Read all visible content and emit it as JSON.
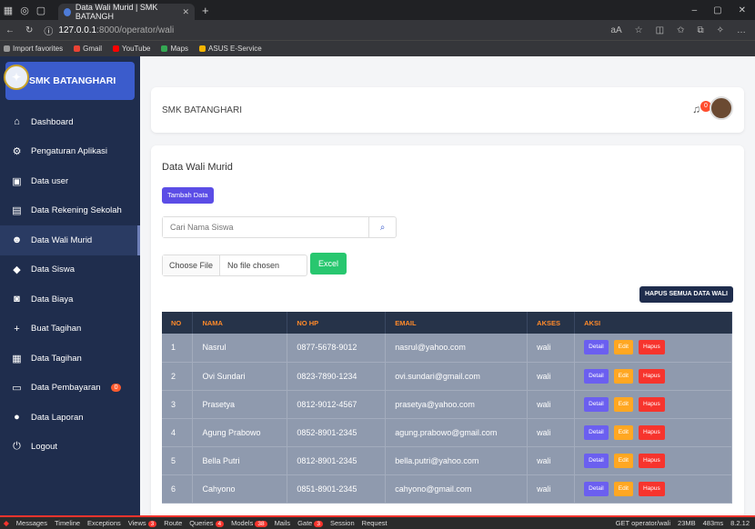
{
  "browser": {
    "tab_title": "Data Wali Murid | SMK BATANGH",
    "url_host": "127.0.0.1",
    "url_path": ":8000/operator/wali",
    "bookmarks": [
      {
        "label": "Import favorites",
        "color": "#999999"
      },
      {
        "label": "Gmail",
        "color": "#ea4335"
      },
      {
        "label": "YouTube",
        "color": "#ff0000"
      },
      {
        "label": "Maps",
        "color": "#34a853"
      },
      {
        "label": "ASUS E-Service",
        "color": "#f4b400"
      }
    ]
  },
  "sidebar": {
    "brand": "SMK BATANGHARI",
    "items": [
      {
        "label": "Dashboard",
        "icon": "home-icon",
        "glyph": "⌂"
      },
      {
        "label": "Pengaturan Aplikasi",
        "icon": "gear-icon",
        "glyph": "⚙"
      },
      {
        "label": "Data user",
        "icon": "user-icon",
        "glyph": "▣"
      },
      {
        "label": "Data Rekening Sekolah",
        "icon": "bank-icon",
        "glyph": "▤"
      },
      {
        "label": "Data Wali Murid",
        "icon": "users-icon",
        "glyph": "☻",
        "active": true
      },
      {
        "label": "Data Siswa",
        "icon": "graduation-cap-icon",
        "glyph": "◆"
      },
      {
        "label": "Data Biaya",
        "icon": "money-icon",
        "glyph": "◙"
      },
      {
        "label": "Buat Tagihan",
        "icon": "plus-icon",
        "glyph": "+"
      },
      {
        "label": "Data Tagihan",
        "icon": "invoice-icon",
        "glyph": "▦"
      },
      {
        "label": "Data Pembayaran",
        "icon": "payment-icon",
        "glyph": "▭",
        "badge": "0"
      },
      {
        "label": "Data Laporan",
        "icon": "info-icon",
        "glyph": "●"
      },
      {
        "label": "Logout",
        "icon": "power-icon",
        "glyph": "⏻"
      }
    ]
  },
  "header": {
    "title": "SMK BATANGHARI",
    "notif_count": "0"
  },
  "main": {
    "title": "Data Wali Murid",
    "add_label": "Tambah Data",
    "search_placeholder": "Cari Nama Siswa",
    "choose_file": "Choose File",
    "no_file": "No file chosen",
    "excel_label": "Excel",
    "delete_all_label": "HAPUS SEMUA DATA WALI"
  },
  "table": {
    "headers": [
      "NO",
      "NAMA",
      "NO HP",
      "EMAIL",
      "AKSES",
      "AKSI"
    ],
    "rows": [
      [
        "1",
        "Nasrul",
        "0877-5678-9012",
        "nasrul@yahoo.com",
        "wali"
      ],
      [
        "2",
        "Ovi Sundari",
        "0823-7890-1234",
        "ovi.sundari@gmail.com",
        "wali"
      ],
      [
        "3",
        "Prasetya",
        "0812-9012-4567",
        "prasetya@yahoo.com",
        "wali"
      ],
      [
        "4",
        "Agung Prabowo",
        "0852-8901-2345",
        "agung.prabowo@gmail.com",
        "wali"
      ],
      [
        "5",
        "Bella Putri",
        "0812-8901-2345",
        "bella.putri@yahoo.com",
        "wali"
      ],
      [
        "6",
        "Cahyono",
        "0851-8901-2345",
        "cahyono@gmail.com",
        "wali"
      ]
    ],
    "actions": {
      "detail": "Detail",
      "edit": "Edit",
      "delete": "Hapus"
    }
  },
  "debugbar": {
    "items": [
      {
        "label": "Messages"
      },
      {
        "label": "Timeline"
      },
      {
        "label": "Exceptions"
      },
      {
        "label": "Views",
        "badge": "3"
      },
      {
        "label": "Route"
      },
      {
        "label": "Queries",
        "badge": "4"
      },
      {
        "label": "Models",
        "badge": "38"
      },
      {
        "label": "Mails"
      },
      {
        "label": "Gate",
        "badge": "3"
      },
      {
        "label": "Session"
      },
      {
        "label": "Request"
      }
    ],
    "right": [
      "GET operator/wali",
      "23MB",
      "483ms",
      "8.2.12"
    ]
  }
}
